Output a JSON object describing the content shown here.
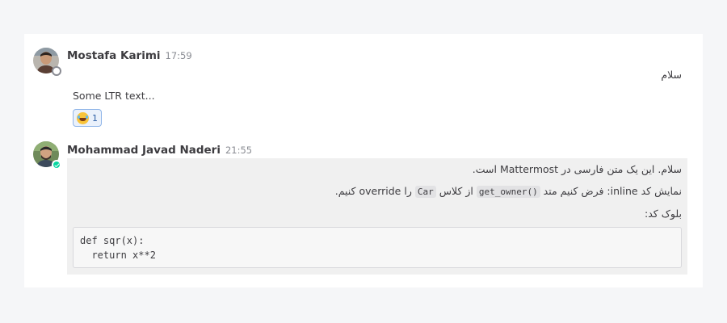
{
  "posts": [
    {
      "author": "Mostafa Karimi",
      "time": "17:59",
      "status": "offline",
      "message_rtl": "سلام",
      "message_ltr": "Some LTR text...",
      "reaction": {
        "emoji": "joy-emoji",
        "count": "1"
      }
    },
    {
      "author": "Mohammad Javad Naderi",
      "time": "21:55",
      "status": "online",
      "line1": "سلام. این یک متن فارسی در Mattermost است.",
      "line2": {
        "part_a": "نمایش کد inline: فرض کنیم متد ",
        "code_a": "get_owner()",
        "part_b": " از کلاس ",
        "code_b": "Car",
        "part_c": " را override کنیم."
      },
      "line3": "بلوک کد:",
      "code_block": "def sqr(x):\n  return x**2"
    }
  ],
  "colors": {
    "online": "#06d6a0",
    "offline": "#8a8c93",
    "reaction_border": "#8fb5e8",
    "highlight": "#f0f0f0"
  }
}
